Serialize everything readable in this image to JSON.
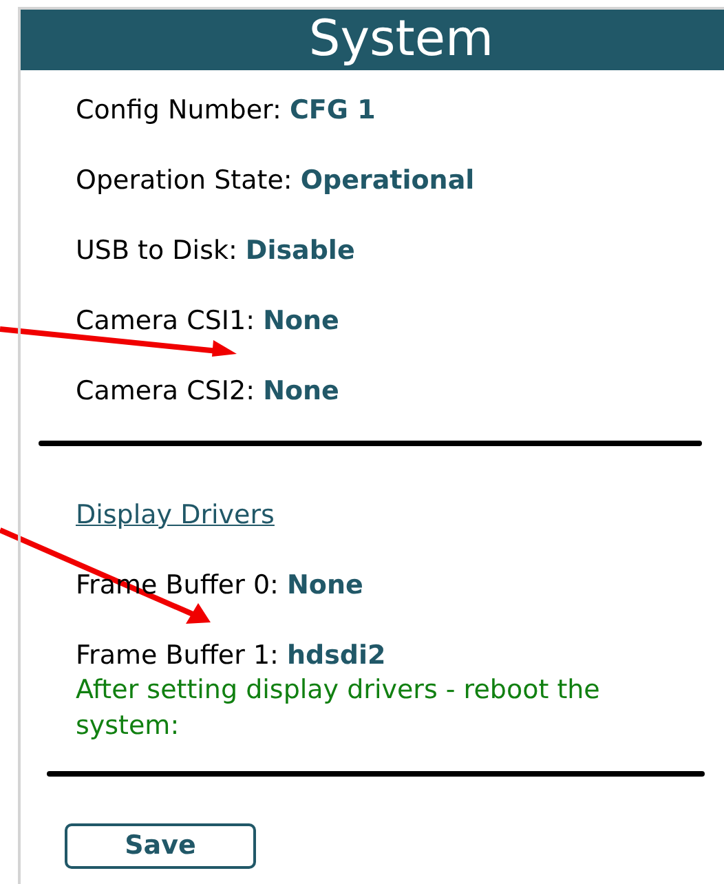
{
  "panel": {
    "title": "System",
    "fields": [
      "Config Number: **CFG 1**",
      "Operation State: **Operational**",
      "USB to Disk: **Disable**",
      "Camera CSI1: **None**",
      "Camera CSI2: **None**"
    ],
    "section_link": "Display Drivers",
    "driver_fields": [
      "Frame Buffer 0: **None**",
      "Frame Buffer 1: **hdsdi2**"
    ],
    "note": "After setting display drivers - reboot the system:",
    "save_button": "Save"
  }
}
